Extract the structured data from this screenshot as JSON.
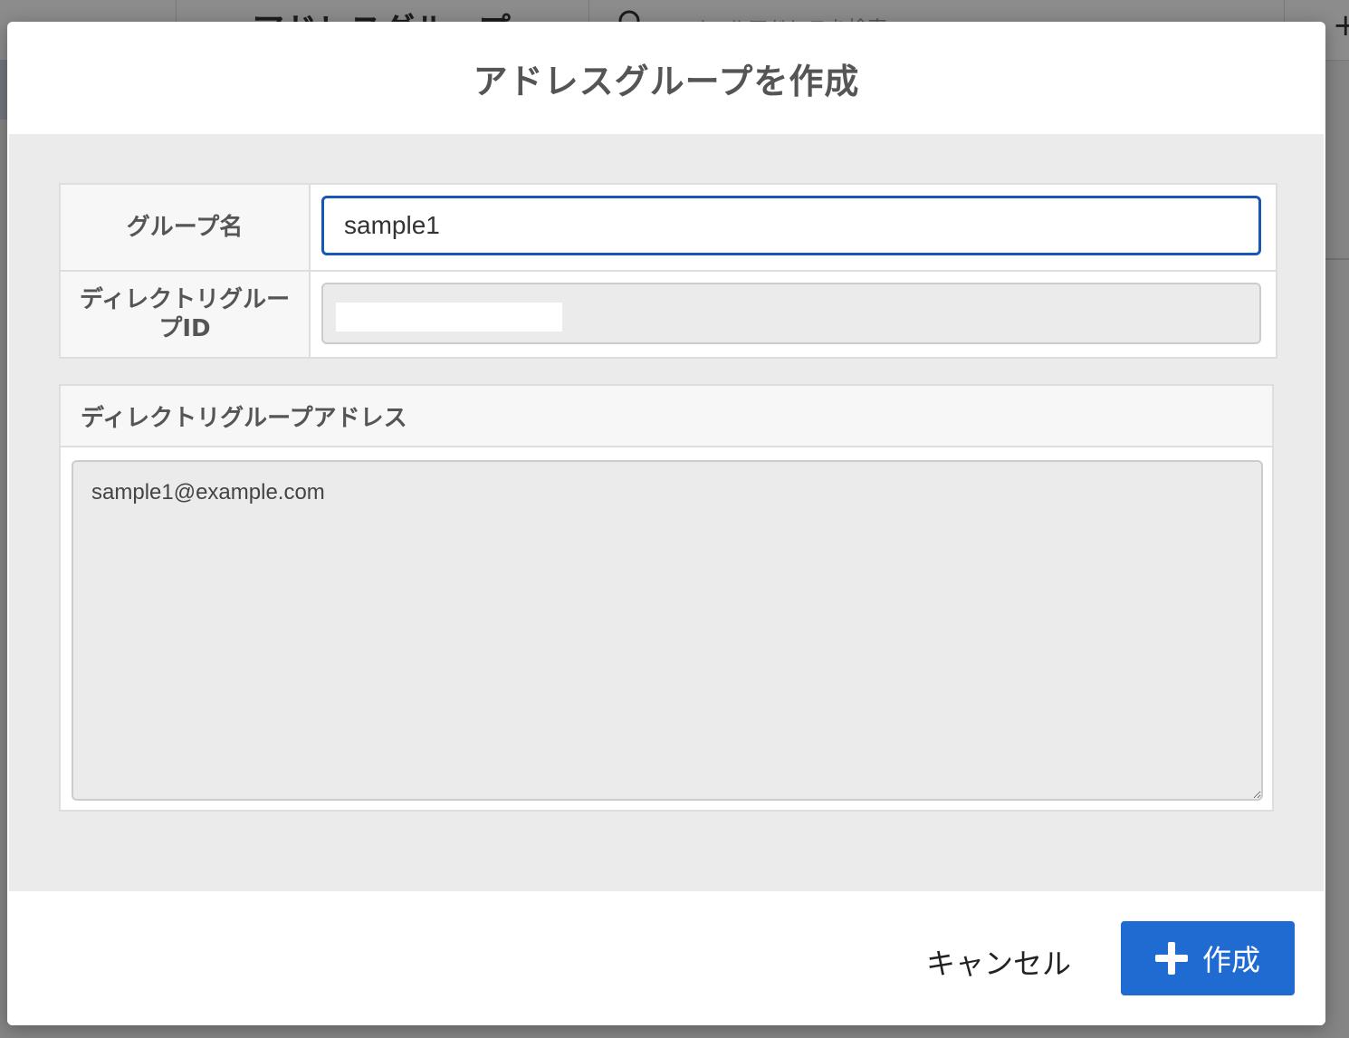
{
  "background": {
    "title": "アドレスグループ",
    "search_placeholder": "メールアドレスを検索"
  },
  "dialog": {
    "title": "アドレスグループを作成",
    "fields": {
      "group_name_label": "グループ名",
      "group_name_value": "sample1",
      "directory_group_id_label": "ディレクトリグループID",
      "directory_group_id_value": ""
    },
    "address_section": {
      "label": "ディレクトリグループアドレス",
      "value": "sample1@example.com"
    },
    "footer": {
      "cancel_label": "キャンセル",
      "create_label": "作成"
    }
  },
  "colors": {
    "primary": "#1f6bd2",
    "input_focus_border": "#1a56b8",
    "body_bg": "#ebebeb"
  }
}
